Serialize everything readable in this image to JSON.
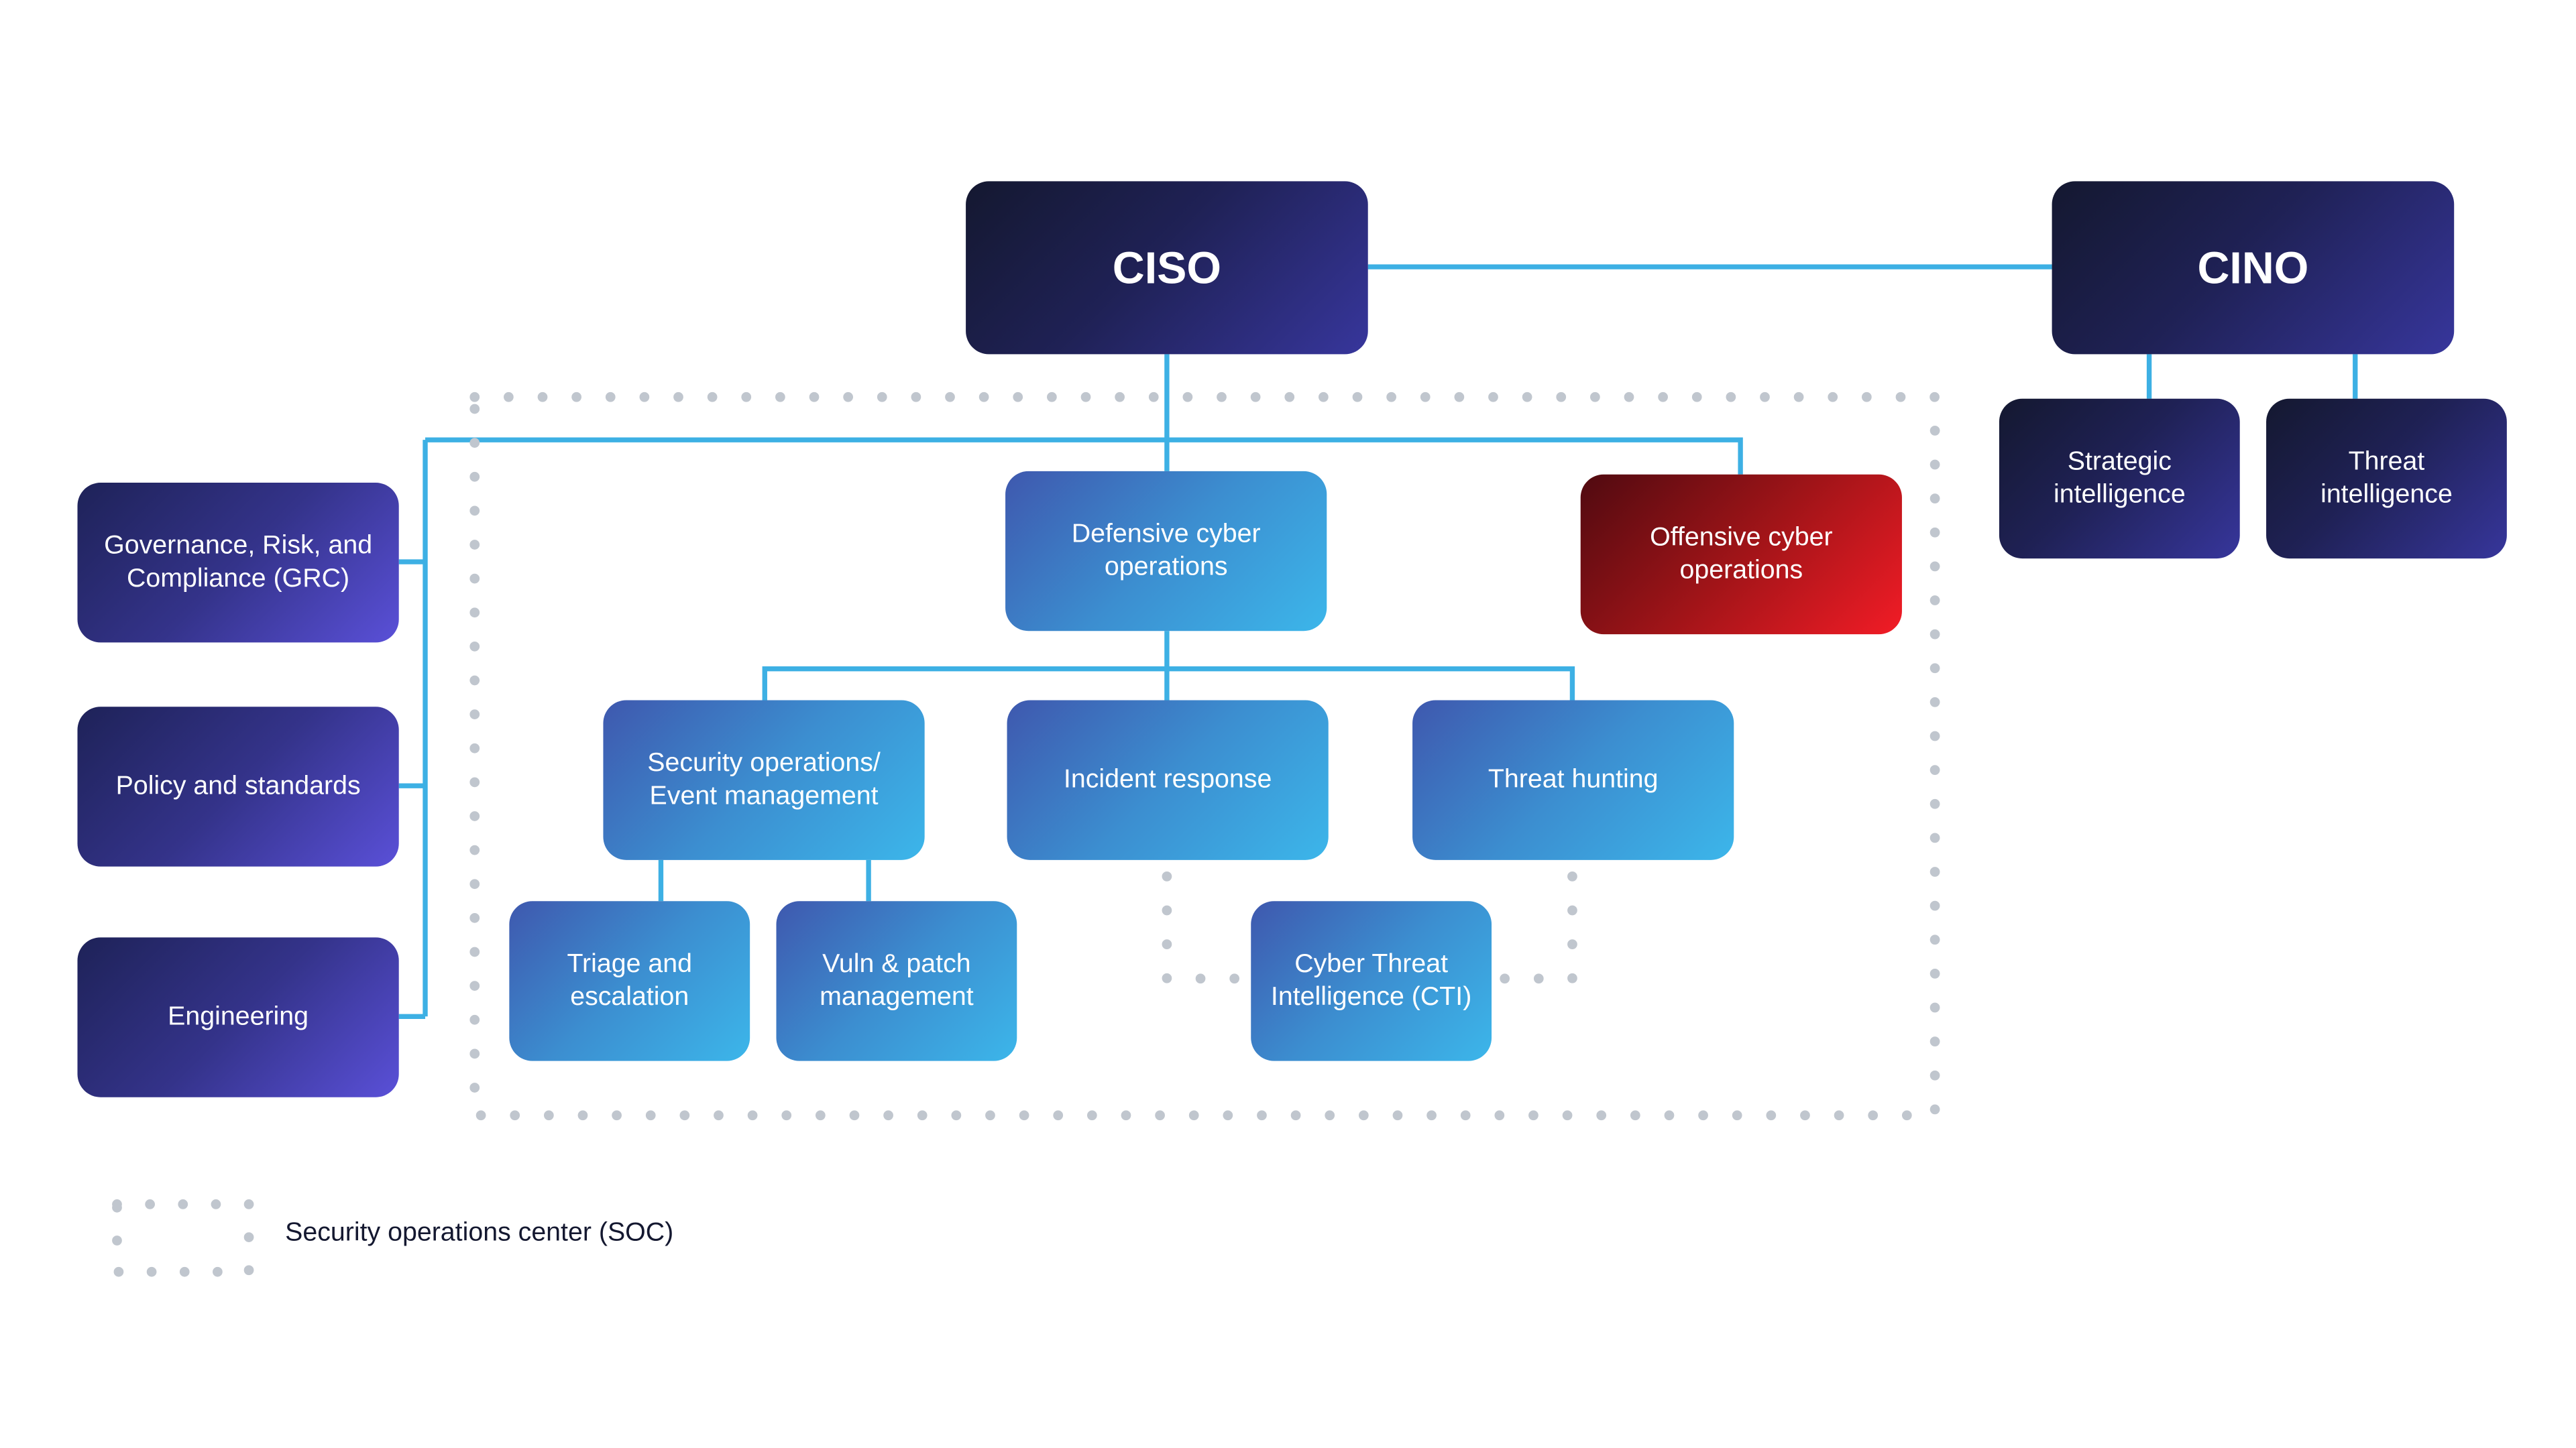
{
  "nodes": {
    "ciso": "CISO",
    "cino": "CINO",
    "strategic": "Strategic intelligence",
    "threat_intel": "Threat intelligence",
    "grc": "Governance, Risk, and Compliance (GRC)",
    "policy": "Policy and standards",
    "engineering": "Engineering",
    "defensive": "Defensive cyber operations",
    "offensive": "Offensive cyber operations",
    "soc_sem": "Security operations/ Event management",
    "incident": "Incident response",
    "hunting": "Threat hunting",
    "triage": "Triage and escalation",
    "vuln": "Vuln & patch management",
    "cti": "Cyber Threat Intelligence (CTI)"
  },
  "legend": {
    "soc": "Security operations center (SOC)"
  },
  "colors": {
    "line": "#3db0e4",
    "dots": "#c0c6ce",
    "dark": "#141830",
    "purple": "#5a50d8",
    "blue": "#3cb6ea",
    "red": "#f21c26"
  }
}
